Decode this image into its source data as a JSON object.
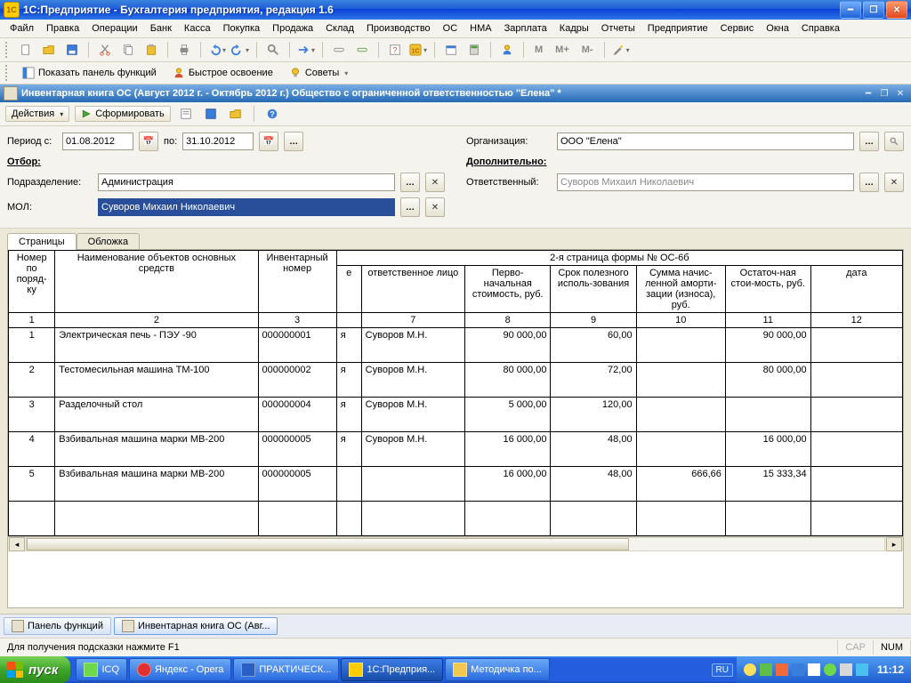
{
  "window": {
    "title": "1С:Предприятие - Бухгалтерия предприятия, редакция 1.6"
  },
  "menu": [
    "Файл",
    "Правка",
    "Операции",
    "Банк",
    "Касса",
    "Покупка",
    "Продажа",
    "Склад",
    "Производство",
    "ОС",
    "НМА",
    "Зарплата",
    "Кадры",
    "Отчеты",
    "Предприятие",
    "Сервис",
    "Окна",
    "Справка"
  ],
  "toolbar2": {
    "show_panel": "Показать панель функций",
    "quick": "Быстрое освоение",
    "tips": "Советы"
  },
  "m_btns": [
    "М",
    "М+",
    "М-"
  ],
  "doc": {
    "title": "Инвентарная книга ОС (Август 2012 г. - Октябрь 2012 г.) Общество с ограниченной ответственностью \"Елена\" *",
    "actions_label": "Действия",
    "form_btn": "Сформировать"
  },
  "filters": {
    "period_lbl": "Период с:",
    "period_from": "01.08.2012",
    "period_to_lbl": "по:",
    "period_to": "31.10.2012",
    "org_lbl": "Организация:",
    "org_val": "ООО \"Елена\"",
    "selection_lbl": "Отбор:",
    "extra_lbl": "Дополнительно:",
    "dept_lbl": "Подразделение:",
    "dept_val": "Администрация",
    "mol_lbl": "МОЛ:",
    "mol_val": "Суворов Михаил Николаевич",
    "resp_lbl": "Ответственный:",
    "resp_val": "Суворов Михаил Николаевич"
  },
  "tabs": {
    "pages": "Страницы",
    "cover": "Обложка"
  },
  "sheet": {
    "page_note": "2-я страница формы № ОС-6б",
    "head": {
      "c1": "Номер по поряд-ку",
      "c2": "Наименование объектов основных средств",
      "c3": "Инвентарный номер",
      "c6": "е",
      "c7": "ответственное лицо",
      "c8": "Перво-начальная стоимость, руб.",
      "c9": "Срок полезного исполь-зования",
      "c10": "Сумма начис-ленной аморти-зации (износа), руб.",
      "c11": "Остаточ-ная стои-мость, руб.",
      "c12": "дата"
    },
    "colnums": {
      "c1": "1",
      "c2": "2",
      "c3": "3",
      "c7": "7",
      "c8": "8",
      "c9": "9",
      "c10": "10",
      "c11": "11",
      "c12": "12"
    },
    "rows": [
      {
        "n": "1",
        "name": "Электрическая печь - ПЭУ -90",
        "inv": "000000001",
        "t": "я",
        "resp": "Суворов М.Н.",
        "cost": "90 000,00",
        "life": "60,00",
        "amort": "",
        "rest": "90 000,00",
        "date": ""
      },
      {
        "n": "2",
        "name": "Тестомесильная машина ТМ-100",
        "inv": "000000002",
        "t": "я",
        "resp": "Суворов М.Н.",
        "cost": "80 000,00",
        "life": "72,00",
        "amort": "",
        "rest": "80 000,00",
        "date": ""
      },
      {
        "n": "3",
        "name": "Разделочный стол",
        "inv": "000000004",
        "t": "я",
        "resp": "Суворов М.Н.",
        "cost": "5 000,00",
        "life": "120,00",
        "amort": "",
        "rest": "",
        "date": ""
      },
      {
        "n": "4",
        "name": "Взбивальная машина марки МВ-200",
        "inv": "000000005",
        "t": "я",
        "resp": "Суворов М.Н.",
        "cost": "16 000,00",
        "life": "48,00",
        "amort": "",
        "rest": "16 000,00",
        "date": ""
      },
      {
        "n": "5",
        "name": "Взбивальная машина марки МВ-200",
        "inv": "000000005",
        "t": "",
        "resp": "",
        "cost": "16 000,00",
        "life": "48,00",
        "amort": "666,66",
        "rest": "15 333,34",
        "date": ""
      }
    ]
  },
  "wintabs": {
    "panel": "Панель функций",
    "doc": "Инвентарная книга ОС (Авг..."
  },
  "status": {
    "hint": "Для получения подсказки нажмите F1",
    "cap": "CAP",
    "num": "NUM"
  },
  "taskbar": {
    "start": "пуск",
    "tasks": [
      "ICQ",
      "Яндекс - Opera",
      "ПРАКТИЧЕСК...",
      "1С:Предприя...",
      "Методичка по..."
    ],
    "lang": "RU",
    "clock": "11:12"
  }
}
